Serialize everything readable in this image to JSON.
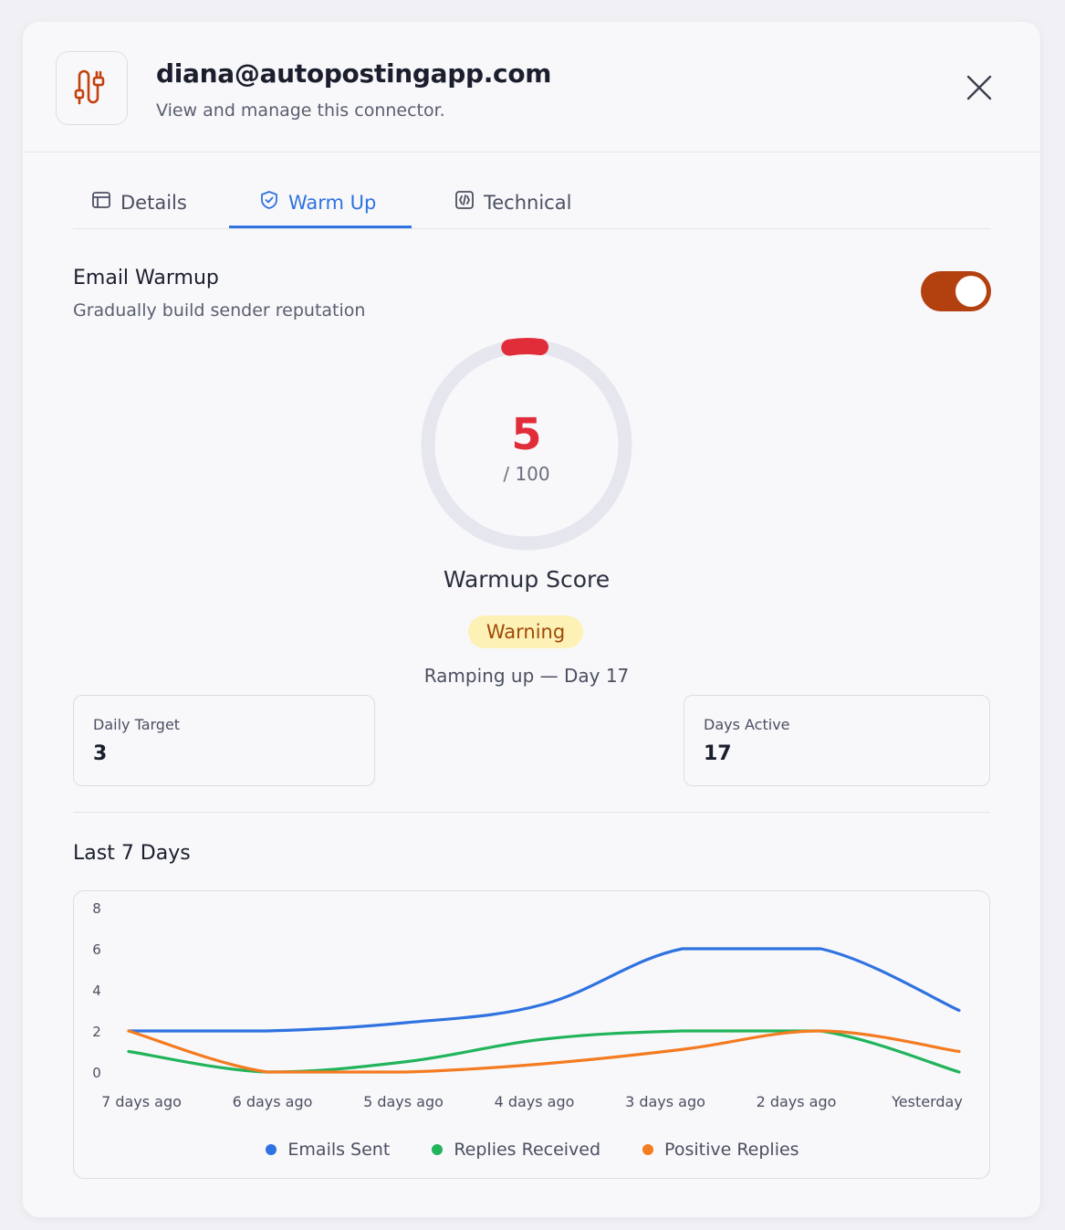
{
  "header": {
    "email": "diana@autopostingapp.com",
    "subtitle": "View and manage this connector.",
    "logo_icon": "plug-icon",
    "close_icon": "close-icon"
  },
  "tabs": [
    {
      "label": "Details",
      "icon": "table-icon",
      "active": false
    },
    {
      "label": "Warm Up",
      "icon": "shield-check-icon",
      "active": true
    },
    {
      "label": "Technical",
      "icon": "code-icon",
      "active": false
    }
  ],
  "warmup": {
    "title": "Email Warmup",
    "subtitle": "Gradually build sender reputation",
    "enabled": true,
    "score": "5",
    "score_max": "/ 100",
    "score_fraction": 0.05,
    "score_label": "Warmup Score",
    "status": "Warning",
    "ramping_text": "Ramping up — Day 17"
  },
  "stats": {
    "daily_target_label": "Daily Target",
    "daily_target_value": "3",
    "days_active_label": "Days Active",
    "days_active_value": "17"
  },
  "chart_section": {
    "title": "Last 7 Days"
  },
  "colors": {
    "accent": "#2f72e0",
    "toggle": "#b3400f",
    "score": "#e12d3a",
    "warning_bg": "#fdf1b6",
    "warning_text": "#a04a06"
  },
  "chart_data": {
    "type": "line",
    "categories": [
      "7 days ago",
      "6 days ago",
      "5 days ago",
      "4 days ago",
      "3 days ago",
      "2 days ago",
      "Yesterday"
    ],
    "y_ticks": [
      "0",
      "2",
      "4",
      "6",
      "8"
    ],
    "ylim": [
      0,
      8
    ],
    "legend_position": "bottom",
    "grid": false,
    "series": [
      {
        "name": "Emails Sent",
        "color": "#2f72e0",
        "values": [
          2,
          2,
          2.4,
          3.3,
          6,
          6,
          3
        ]
      },
      {
        "name": "Replies Received",
        "color": "#22b45a",
        "values": [
          1,
          0,
          0.5,
          1.6,
          2,
          2,
          0
        ]
      },
      {
        "name": "Positive Replies",
        "color": "#f47b20",
        "values": [
          2,
          0,
          0,
          0.4,
          1.1,
          2,
          1
        ]
      }
    ]
  }
}
